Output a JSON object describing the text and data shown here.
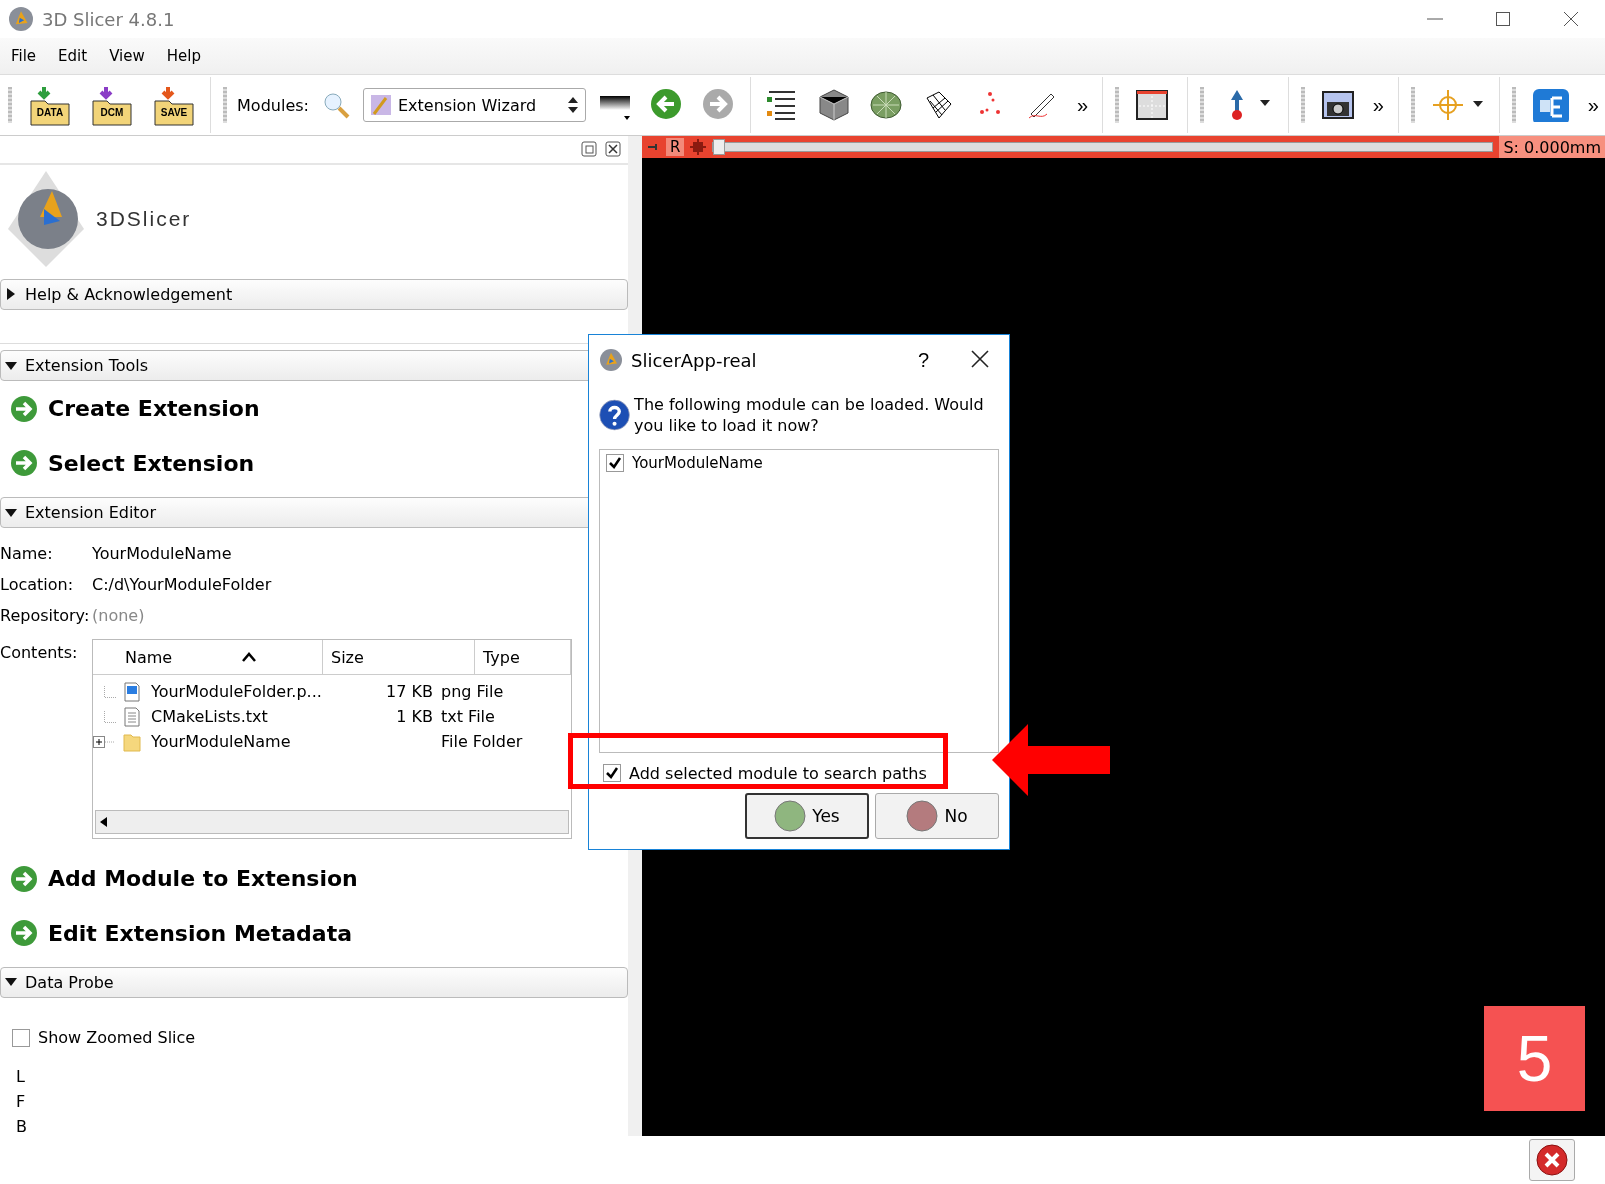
{
  "window": {
    "title": "3D Slicer 4.8.1"
  },
  "menu": [
    "File",
    "Edit",
    "View",
    "Help"
  ],
  "toolbar": {
    "file_buttons": [
      "DATA",
      "DCM",
      "SAVE"
    ],
    "modules_label": "Modules:",
    "module_select": "Extension Wizard",
    "overflow": [
      "»",
      "»",
      "»"
    ]
  },
  "slice_view": {
    "orientation": "R",
    "offset": "S: 0.000mm",
    "level": 0
  },
  "panel": {
    "logo_text": "3DSlicer",
    "help": {
      "title": "Help & Acknowledgement",
      "expanded": false
    },
    "extension_tools": {
      "title": "Extension Tools",
      "expanded": true,
      "actions": [
        "Create Extension",
        "Select Extension"
      ]
    },
    "extension_editor": {
      "title": "Extension Editor",
      "expanded": true,
      "fields": [
        {
          "label": "Name:",
          "value": "YourModuleName",
          "muted": false
        },
        {
          "label": "Location:",
          "value": "C:/d\\YourModuleFolder",
          "muted": false
        },
        {
          "label": "Repository:",
          "value": "(none)",
          "muted": true
        }
      ],
      "contents_label": "Contents:",
      "tree": {
        "columns": [
          {
            "label": "Name",
            "sorted": true
          },
          {
            "label": "Size",
            "sorted": false
          },
          {
            "label": "Type",
            "sorted": false
          }
        ],
        "rows": [
          {
            "name": "YourModuleFolder.p...",
            "size": "17 KB",
            "type": "png File",
            "kind": "image",
            "expandable": false
          },
          {
            "name": "CMakeLists.txt",
            "size": "1 KB",
            "type": "txt File",
            "kind": "text",
            "expandable": false
          },
          {
            "name": "YourModuleName",
            "type": "File Folder",
            "kind": "folder",
            "expandable": true
          }
        ]
      },
      "actions": [
        "Add Module to Extension",
        "Edit Extension Metadata"
      ]
    },
    "data_probe": {
      "title": "Data Probe",
      "expanded": true,
      "show_zoomed": {
        "label": "Show Zoomed Slice",
        "checked": false
      },
      "coords": [
        "L",
        "F",
        "B"
      ]
    }
  },
  "dialog": {
    "title": "SlicerApp-real",
    "help": "?",
    "message": "The following module can be loaded. Would you like to load it now?",
    "modules": [
      {
        "name": "YourModuleName",
        "checked": true
      }
    ],
    "add_to_paths": {
      "label": "Add selected module to search paths",
      "checked": true
    },
    "buttons": [
      {
        "label": "Yes",
        "kind": "yes"
      },
      {
        "label": "No",
        "kind": "no"
      }
    ]
  },
  "annotation": {
    "step": "5"
  }
}
